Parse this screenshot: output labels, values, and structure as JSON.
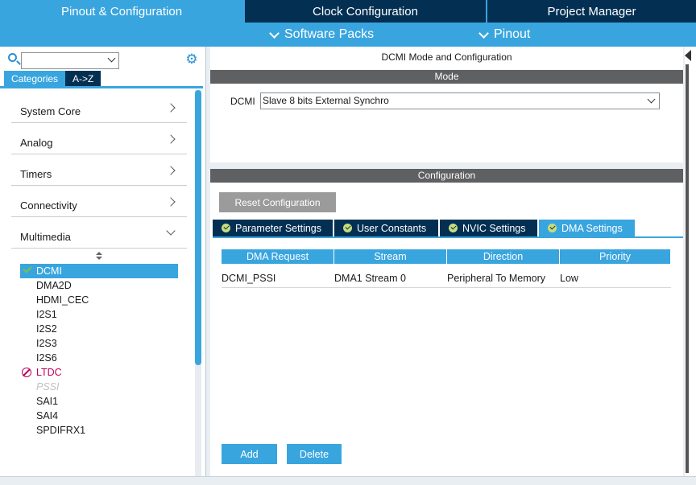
{
  "top_tabs": [
    "Pinout & Configuration",
    "Clock Configuration",
    "Project Manager"
  ],
  "sub_menu": {
    "software_packs": "Software Packs",
    "pinout": "Pinout"
  },
  "left": {
    "search": {
      "value": "",
      "placeholder": ""
    },
    "view_tabs": [
      "Categories",
      "A->Z"
    ],
    "categories": [
      "System Core",
      "Analog",
      "Timers",
      "Connectivity",
      "Multimedia"
    ],
    "peripherals": [
      {
        "label": "DCMI",
        "state": "selected"
      },
      {
        "label": "DMA2D",
        "state": "normal"
      },
      {
        "label": "HDMI_CEC",
        "state": "normal"
      },
      {
        "label": "I2S1",
        "state": "normal"
      },
      {
        "label": "I2S2",
        "state": "normal"
      },
      {
        "label": "I2S3",
        "state": "normal"
      },
      {
        "label": "I2S6",
        "state": "normal"
      },
      {
        "label": "LTDC",
        "state": "error"
      },
      {
        "label": "PSSI",
        "state": "disabled"
      },
      {
        "label": "SAI1",
        "state": "normal"
      },
      {
        "label": "SAI4",
        "state": "normal"
      },
      {
        "label": "SPDIFRX1",
        "state": "normal"
      }
    ]
  },
  "mode_panel": {
    "title": "DCMI Mode and Configuration",
    "header": "Mode",
    "dcmi_label": "DCMI",
    "dcmi_value": "Slave 8 bits External Synchro"
  },
  "config_panel": {
    "header": "Configuration",
    "reset_button": "Reset Configuration",
    "tabs": [
      "Parameter Settings",
      "User Constants",
      "NVIC Settings",
      "DMA Settings"
    ],
    "active_tab": "DMA Settings",
    "table": {
      "columns": [
        "DMA Request",
        "Stream",
        "Direction",
        "Priority"
      ],
      "rows": [
        [
          "DCMI_PSSI",
          "DMA1 Stream 0",
          "Peripheral To Memory",
          "Low"
        ]
      ]
    },
    "add_button": "Add",
    "delete_button": "Delete"
  },
  "colors": {
    "accent": "#39a5df",
    "navy": "#032f53",
    "error": "#c0005a",
    "ok": "#7ac143"
  }
}
